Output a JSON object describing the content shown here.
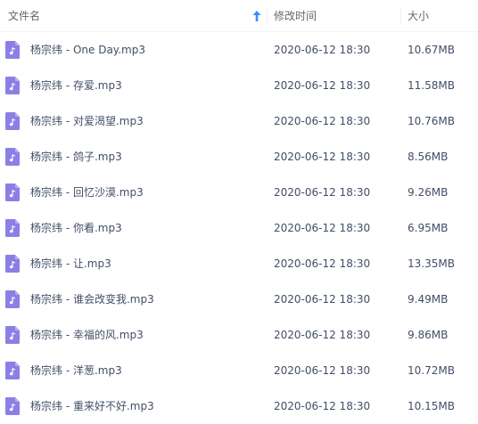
{
  "header": {
    "name_label": "文件名",
    "date_label": "修改时间",
    "size_label": "大小"
  },
  "colors": {
    "icon": "#8b7fe6",
    "sort_arrow": "#3b8cf8"
  },
  "files": [
    {
      "name": "杨宗纬 - One Day.mp3",
      "date": "2020-06-12 18:30",
      "size": "10.67MB",
      "icon": "music-file-icon"
    },
    {
      "name": "杨宗纬 - 存爱.mp3",
      "date": "2020-06-12 18:30",
      "size": "11.58MB",
      "icon": "music-file-icon"
    },
    {
      "name": "杨宗纬 - 对爱渴望.mp3",
      "date": "2020-06-12 18:30",
      "size": "10.76MB",
      "icon": "music-file-icon"
    },
    {
      "name": "杨宗纬 - 鸽子.mp3",
      "date": "2020-06-12 18:30",
      "size": "8.56MB",
      "icon": "music-file-icon"
    },
    {
      "name": "杨宗纬 - 回忆沙漠.mp3",
      "date": "2020-06-12 18:30",
      "size": "9.26MB",
      "icon": "music-file-icon"
    },
    {
      "name": "杨宗纬 - 你看.mp3",
      "date": "2020-06-12 18:30",
      "size": "6.95MB",
      "icon": "music-file-icon"
    },
    {
      "name": "杨宗纬 - 让.mp3",
      "date": "2020-06-12 18:30",
      "size": "13.35MB",
      "icon": "music-file-icon"
    },
    {
      "name": "杨宗纬 - 谁会改变我.mp3",
      "date": "2020-06-12 18:30",
      "size": "9.49MB",
      "icon": "music-file-icon"
    },
    {
      "name": "杨宗纬 - 幸福的风.mp3",
      "date": "2020-06-12 18:30",
      "size": "9.86MB",
      "icon": "music-file-icon"
    },
    {
      "name": "杨宗纬 - 洋葱.mp3",
      "date": "2020-06-12 18:30",
      "size": "10.72MB",
      "icon": "music-file-icon"
    },
    {
      "name": "杨宗纬 - 重来好不好.mp3",
      "date": "2020-06-12 18:30",
      "size": "10.15MB",
      "icon": "music-file-icon"
    }
  ]
}
